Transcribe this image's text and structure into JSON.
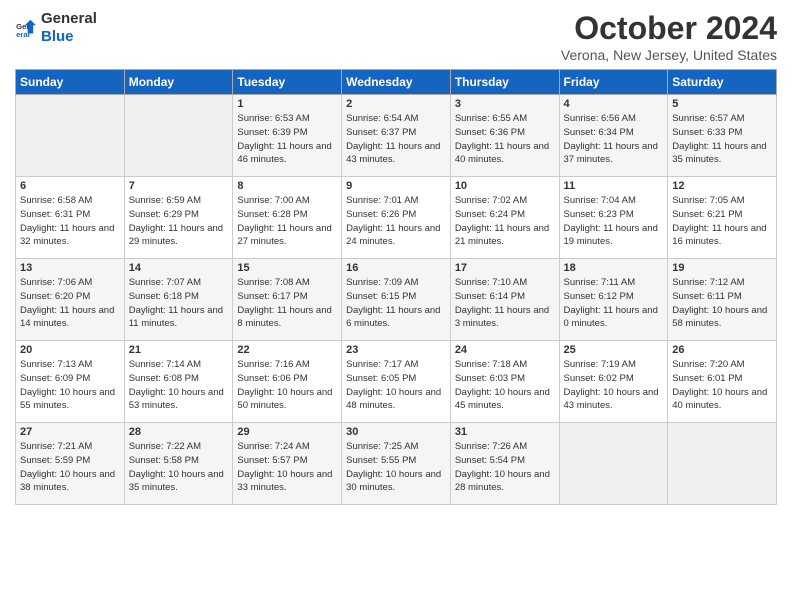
{
  "header": {
    "logo_general": "General",
    "logo_blue": "Blue",
    "month": "October 2024",
    "location": "Verona, New Jersey, United States"
  },
  "days_of_week": [
    "Sunday",
    "Monday",
    "Tuesday",
    "Wednesday",
    "Thursday",
    "Friday",
    "Saturday"
  ],
  "weeks": [
    [
      {
        "day": "",
        "info": ""
      },
      {
        "day": "",
        "info": ""
      },
      {
        "day": "1",
        "info": "Sunrise: 6:53 AM\nSunset: 6:39 PM\nDaylight: 11 hours and 46 minutes."
      },
      {
        "day": "2",
        "info": "Sunrise: 6:54 AM\nSunset: 6:37 PM\nDaylight: 11 hours and 43 minutes."
      },
      {
        "day": "3",
        "info": "Sunrise: 6:55 AM\nSunset: 6:36 PM\nDaylight: 11 hours and 40 minutes."
      },
      {
        "day": "4",
        "info": "Sunrise: 6:56 AM\nSunset: 6:34 PM\nDaylight: 11 hours and 37 minutes."
      },
      {
        "day": "5",
        "info": "Sunrise: 6:57 AM\nSunset: 6:33 PM\nDaylight: 11 hours and 35 minutes."
      }
    ],
    [
      {
        "day": "6",
        "info": "Sunrise: 6:58 AM\nSunset: 6:31 PM\nDaylight: 11 hours and 32 minutes."
      },
      {
        "day": "7",
        "info": "Sunrise: 6:59 AM\nSunset: 6:29 PM\nDaylight: 11 hours and 29 minutes."
      },
      {
        "day": "8",
        "info": "Sunrise: 7:00 AM\nSunset: 6:28 PM\nDaylight: 11 hours and 27 minutes."
      },
      {
        "day": "9",
        "info": "Sunrise: 7:01 AM\nSunset: 6:26 PM\nDaylight: 11 hours and 24 minutes."
      },
      {
        "day": "10",
        "info": "Sunrise: 7:02 AM\nSunset: 6:24 PM\nDaylight: 11 hours and 21 minutes."
      },
      {
        "day": "11",
        "info": "Sunrise: 7:04 AM\nSunset: 6:23 PM\nDaylight: 11 hours and 19 minutes."
      },
      {
        "day": "12",
        "info": "Sunrise: 7:05 AM\nSunset: 6:21 PM\nDaylight: 11 hours and 16 minutes."
      }
    ],
    [
      {
        "day": "13",
        "info": "Sunrise: 7:06 AM\nSunset: 6:20 PM\nDaylight: 11 hours and 14 minutes."
      },
      {
        "day": "14",
        "info": "Sunrise: 7:07 AM\nSunset: 6:18 PM\nDaylight: 11 hours and 11 minutes."
      },
      {
        "day": "15",
        "info": "Sunrise: 7:08 AM\nSunset: 6:17 PM\nDaylight: 11 hours and 8 minutes."
      },
      {
        "day": "16",
        "info": "Sunrise: 7:09 AM\nSunset: 6:15 PM\nDaylight: 11 hours and 6 minutes."
      },
      {
        "day": "17",
        "info": "Sunrise: 7:10 AM\nSunset: 6:14 PM\nDaylight: 11 hours and 3 minutes."
      },
      {
        "day": "18",
        "info": "Sunrise: 7:11 AM\nSunset: 6:12 PM\nDaylight: 11 hours and 0 minutes."
      },
      {
        "day": "19",
        "info": "Sunrise: 7:12 AM\nSunset: 6:11 PM\nDaylight: 10 hours and 58 minutes."
      }
    ],
    [
      {
        "day": "20",
        "info": "Sunrise: 7:13 AM\nSunset: 6:09 PM\nDaylight: 10 hours and 55 minutes."
      },
      {
        "day": "21",
        "info": "Sunrise: 7:14 AM\nSunset: 6:08 PM\nDaylight: 10 hours and 53 minutes."
      },
      {
        "day": "22",
        "info": "Sunrise: 7:16 AM\nSunset: 6:06 PM\nDaylight: 10 hours and 50 minutes."
      },
      {
        "day": "23",
        "info": "Sunrise: 7:17 AM\nSunset: 6:05 PM\nDaylight: 10 hours and 48 minutes."
      },
      {
        "day": "24",
        "info": "Sunrise: 7:18 AM\nSunset: 6:03 PM\nDaylight: 10 hours and 45 minutes."
      },
      {
        "day": "25",
        "info": "Sunrise: 7:19 AM\nSunset: 6:02 PM\nDaylight: 10 hours and 43 minutes."
      },
      {
        "day": "26",
        "info": "Sunrise: 7:20 AM\nSunset: 6:01 PM\nDaylight: 10 hours and 40 minutes."
      }
    ],
    [
      {
        "day": "27",
        "info": "Sunrise: 7:21 AM\nSunset: 5:59 PM\nDaylight: 10 hours and 38 minutes."
      },
      {
        "day": "28",
        "info": "Sunrise: 7:22 AM\nSunset: 5:58 PM\nDaylight: 10 hours and 35 minutes."
      },
      {
        "day": "29",
        "info": "Sunrise: 7:24 AM\nSunset: 5:57 PM\nDaylight: 10 hours and 33 minutes."
      },
      {
        "day": "30",
        "info": "Sunrise: 7:25 AM\nSunset: 5:55 PM\nDaylight: 10 hours and 30 minutes."
      },
      {
        "day": "31",
        "info": "Sunrise: 7:26 AM\nSunset: 5:54 PM\nDaylight: 10 hours and 28 minutes."
      },
      {
        "day": "",
        "info": ""
      },
      {
        "day": "",
        "info": ""
      }
    ]
  ]
}
